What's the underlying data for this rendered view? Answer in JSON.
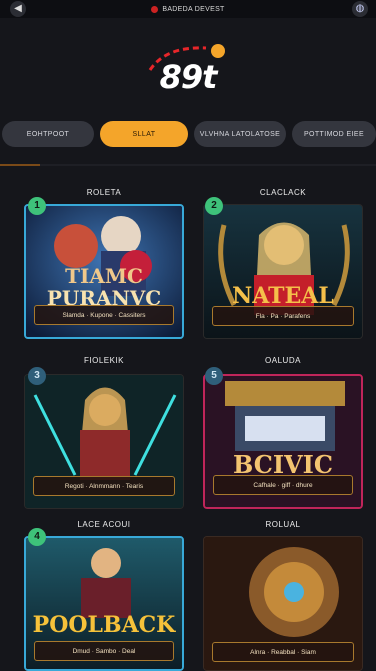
{
  "header": {
    "site_name": "BADEDA DEVEST",
    "back_icon": "back-arrow-icon",
    "globe_icon": "globe-icon"
  },
  "logo": {
    "text": "89t",
    "accent": "#e8262a",
    "dot": "#f4a52a"
  },
  "tabs": [
    {
      "label": "EOHTPOOT",
      "active": false
    },
    {
      "label": "SLLAT",
      "active": true
    },
    {
      "label": "VLVHNA LATOLATOSE",
      "active": false
    },
    {
      "label": "POTTIMOD EIEE",
      "active": false
    }
  ],
  "games": [
    {
      "category": "ROLETA",
      "badge": "1",
      "title_line1": "TIAMC",
      "title_line2": "PURANVC",
      "subtitle": "Slamda · Kupone · Cassiters"
    },
    {
      "category": "CLACLACK",
      "badge": "2",
      "title_line1": "",
      "title_line2": "NATEAL",
      "subtitle": "Fla · Pa · Parafens"
    },
    {
      "category": "FIOLEKIK",
      "badge": "3",
      "title_line1": "",
      "title_line2": "",
      "subtitle": "Regoti · Alnmmann · Tearis"
    },
    {
      "category": "OALUDA",
      "badge": "5",
      "title_line1": "",
      "title_line2": "BCIVIC",
      "subtitle": "Cafhale · giff · dhure"
    },
    {
      "category": "LACE ACOUI",
      "badge": "4",
      "title_line1": "",
      "title_line2": "POOLBACK",
      "subtitle": "Dmud · Sambo · Deal"
    },
    {
      "category": "ROLUAL",
      "badge": "",
      "title_line1": "",
      "title_line2": "",
      "subtitle": "Alnra · Reabbal · Siam"
    }
  ]
}
